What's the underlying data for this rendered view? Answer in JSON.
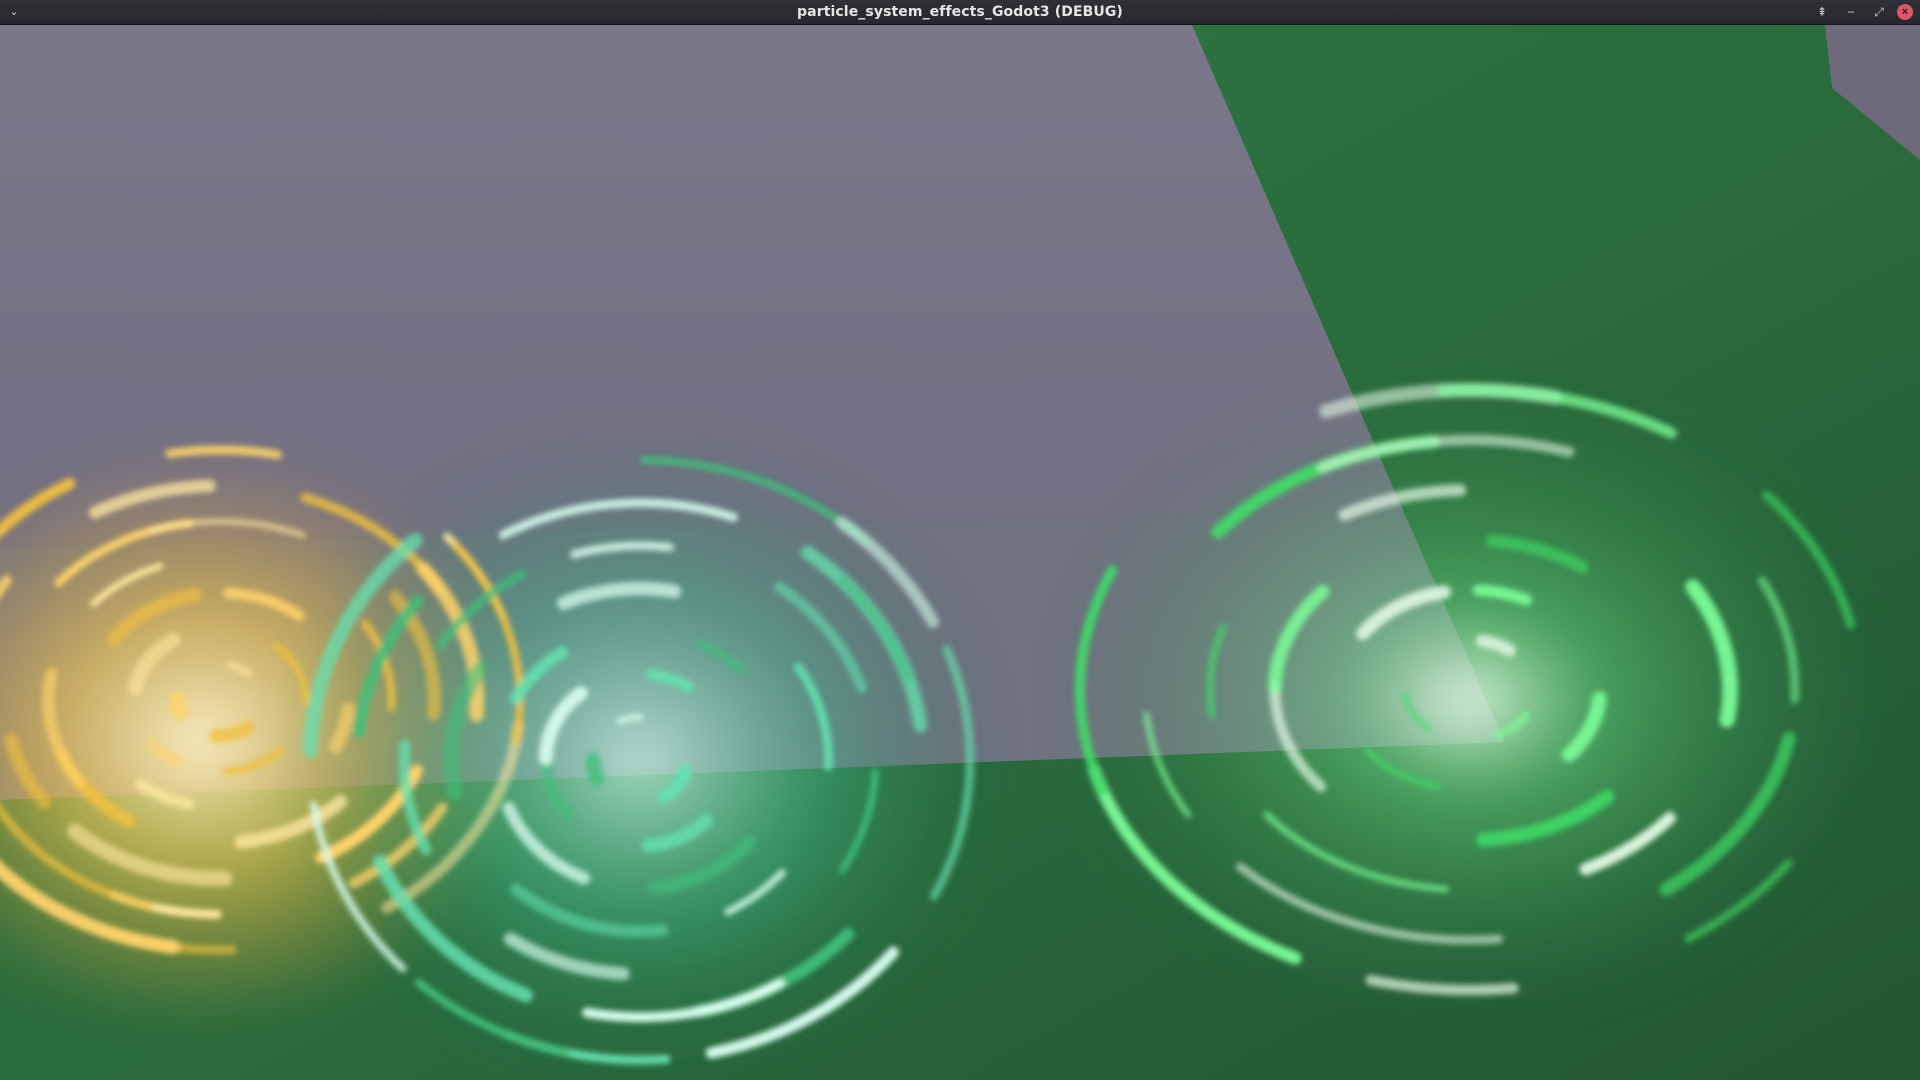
{
  "window": {
    "title": "particle_system_effects_Godot3 (DEBUG)",
    "menu_icon": "chevron-down-icon",
    "controls": [
      {
        "name": "pin-icon",
        "glyph": "⇞"
      },
      {
        "name": "minimize-icon",
        "glyph": "−"
      },
      {
        "name": "maximize-icon",
        "glyph": "⤢"
      },
      {
        "name": "close-icon",
        "glyph": "×"
      }
    ]
  },
  "scene": {
    "floor_color": "#2d6a3d",
    "wall_color": "#767386",
    "corner_wall_color": "#6e6a7c",
    "emitters": [
      {
        "name": "yellow-vortex-emitter",
        "colors": [
          "#ffe9a0",
          "#f0c040",
          "#ffd36a"
        ]
      },
      {
        "name": "cyan-green-vortex-emitter",
        "colors": [
          "#d8fff0",
          "#64e0b0",
          "#3fbf7a"
        ]
      },
      {
        "name": "green-vortex-emitter",
        "colors": [
          "#eaffea",
          "#7dff9a",
          "#3fdc66"
        ]
      }
    ]
  }
}
